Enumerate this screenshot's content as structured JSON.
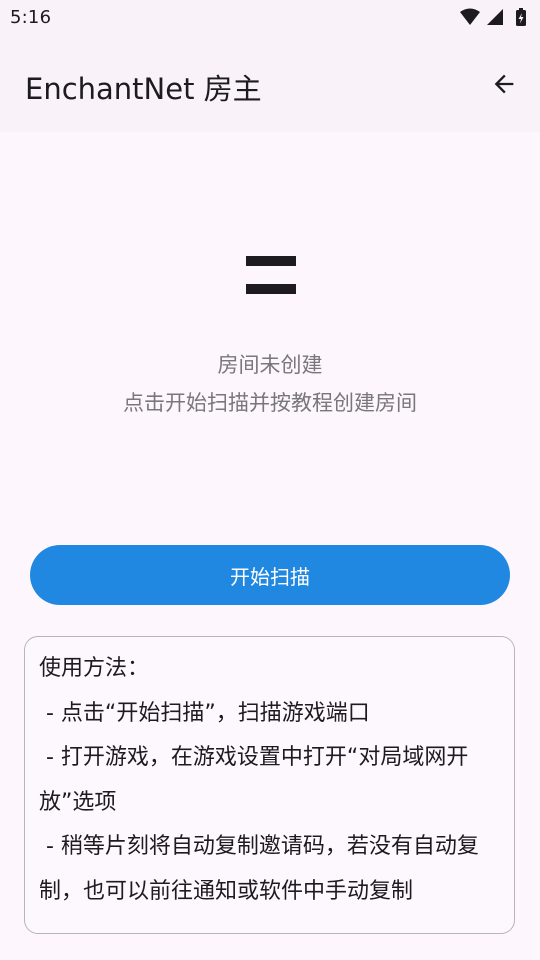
{
  "status_bar": {
    "time": "5:16",
    "icons": [
      "wifi-icon",
      "signal-icon",
      "battery-charging-icon"
    ]
  },
  "app_bar": {
    "title": "EnchantNet 房主",
    "back_icon": "arrow-back-icon"
  },
  "main": {
    "center_icon": "equals-icon",
    "status_line1": "房间未创建",
    "status_line2": "点击开始扫描并按教程创建房间",
    "scan_button_label": "开始扫描"
  },
  "usage": {
    "text": "使用方法：\n - 点击“开始扫描”，扫描游戏端口\n - 打开游戏，在游戏设置中打开“对局域网开放”选项\n - 稍等片刻将自动复制邀请码，若没有自动复制，也可以前往通知或软件中手动复制"
  },
  "colors": {
    "accent": "#2188e1",
    "background": "#fdf7fd",
    "app_bar": "#f9f2f9",
    "muted_text": "#7a767d",
    "border": "#b8b4ba"
  }
}
